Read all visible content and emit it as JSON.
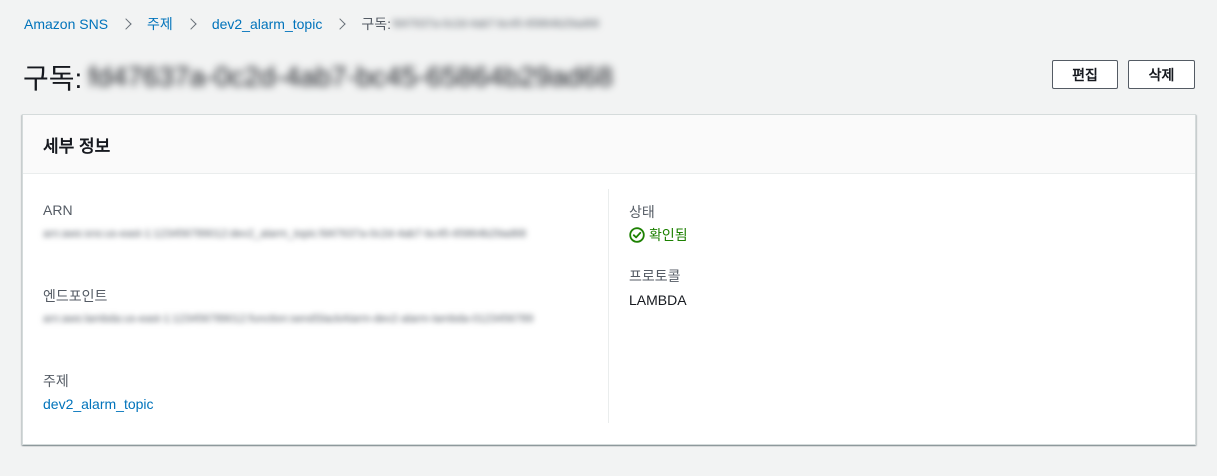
{
  "breadcrumb": {
    "items": [
      "Amazon SNS",
      "주제",
      "dev2_alarm_topic"
    ],
    "current_prefix": "구독:",
    "current_id": "fd47637a-0c2d-4ab7-bc45-65864b29ad68"
  },
  "header": {
    "title_prefix": "구독:",
    "title_id": "fd47637a-0c2d-4ab7-bc45-65864b29ad68",
    "edit_label": "편집",
    "delete_label": "삭제"
  },
  "details": {
    "title": "세부 정보",
    "arn_label": "ARN",
    "arn_value": "arn:aws:sns:us-east-1:123456789012:dev2_alarm_topic:fd47637a-0c2d-4ab7-bc45-65864b29ad68",
    "endpoint_label": "엔드포인트",
    "endpoint_value": "arn:aws:lambda:us-east-1:123456789012:function:sendSlackAlarm-dev2-alarm-lambda-0123456789",
    "topic_label": "주제",
    "topic_value": "dev2_alarm_topic",
    "status_label": "상태",
    "status_value": "확인됨",
    "status_color": "#1d8102",
    "status_icon": "check-circle-icon",
    "protocol_label": "프로토콜",
    "protocol_value": "LAMBDA"
  },
  "colors": {
    "link": "#0073bb",
    "background": "#f2f3f3"
  }
}
